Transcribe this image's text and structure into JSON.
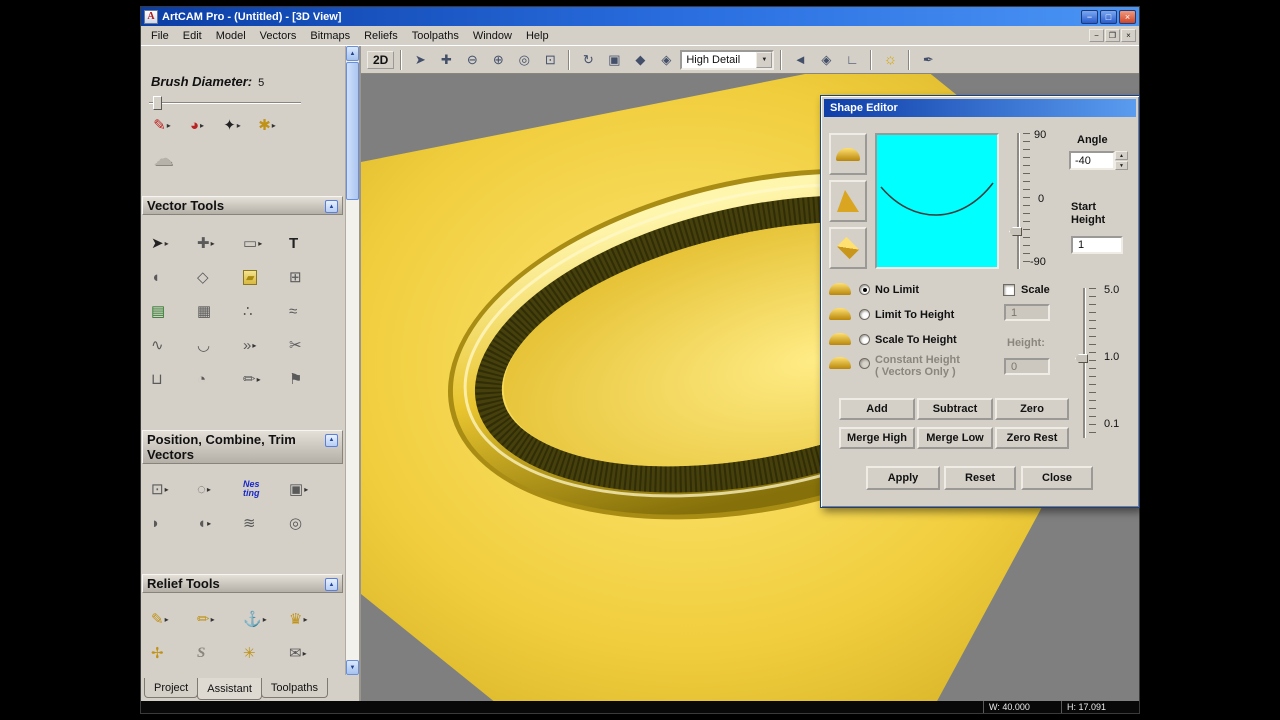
{
  "window": {
    "title": "ArtCAM Pro - (Untitled) - [3D View]",
    "menu": [
      "File",
      "Edit",
      "Model",
      "Vectors",
      "Bitmaps",
      "Reliefs",
      "Toolpaths",
      "Window",
      "Help"
    ],
    "toolbar": {
      "mode_2d": "2D",
      "detail_select": "High Detail"
    },
    "status": {
      "w": "W: 40.000",
      "h": "H: 17.091"
    }
  },
  "panel": {
    "brush_label": "Brush Diameter:",
    "brush_value": "5",
    "vector_tools_header": "Vector Tools",
    "pct_header": "Position, Combine, Trim Vectors",
    "relief_tools_header": "Relief Tools",
    "nesting_1": "Nes",
    "nesting_2": "ting",
    "tabs": [
      "Project",
      "Assistant",
      "Toolpaths"
    ]
  },
  "shape_editor": {
    "title": "Shape Editor",
    "angle_label": "Angle",
    "angle_value": "-40",
    "start_height_label": "Start Height",
    "start_height_value": "1",
    "angle_slider": {
      "top": "90",
      "mid": "0",
      "bottom": "-90"
    },
    "options": [
      "No Limit",
      "Limit To Height",
      "Scale To Height",
      "Constant Height",
      "( Vectors Only )"
    ],
    "scale_label": "Scale",
    "height_label": "Height:",
    "limit_height_value": "1",
    "constant_height_value": "0",
    "height_slider": {
      "top": "5.0",
      "mid": "1.0",
      "bottom": "0.1"
    },
    "buttons": [
      "Add",
      "Subtract",
      "Zero",
      "Merge High",
      "Merge Low",
      "Zero Rest"
    ],
    "actions": [
      "Apply",
      "Reset",
      "Close"
    ]
  },
  "colors": {
    "titlebar_start": "#0b3ea5",
    "titlebar_end": "#4b95f5",
    "panel_bg": "#d4d0c8",
    "view_bg": "#7f7f7f",
    "relief_gold": "#e8c42e",
    "preview_bg": "#00ffff"
  },
  "icons": {
    "app": "A",
    "tri_up": "▲",
    "tri_down": "▼",
    "tri_right": "▸",
    "tri_left": "◄",
    "minimize": "−",
    "maximize": "□",
    "close": "×",
    "restore": "❐",
    "select": "➤",
    "pan": "✚",
    "zoom_out": "⊖",
    "zoom_in": "⊕",
    "zoom_window": "◎",
    "zoom_fit": "⊡",
    "rotate": "↻",
    "shade_flat": "▣",
    "shade_iso": "◆",
    "shade_gouraud": "◈",
    "back": "◄",
    "corner": "∟",
    "bulb": "☼",
    "pen_tool": "✒",
    "pencil": "✎",
    "pie": "◕",
    "spray": "✦",
    "palette": "✱",
    "cloud": "☁",
    "v_select": "➤",
    "v_transform": "✚",
    "v_rect": "▭",
    "v_text": "T",
    "v_shape": "◖",
    "v_poly": "◇",
    "v_measure": "▰",
    "v_block": "⊞",
    "v_table": "▤",
    "v_grid": "▦",
    "v_dots": "∴",
    "v_arcs": "≈",
    "v_wave": "∿",
    "v_arc": "◡",
    "v_join": "»",
    "v_scissors": "✂",
    "v_cyl": "⊔",
    "v_pie": "◔",
    "v_pencil": "✏",
    "v_flag": "⚑",
    "c_align": "⊡",
    "c_circle": "◌",
    "c_window": "▣",
    "c_blob1": "◗",
    "c_blob2": "◖",
    "c_waves": "≋",
    "c_spiral": "◎",
    "r_pen": "✎",
    "r_chisel": "✏",
    "r_anchor": "⚓",
    "r_crown": "♛",
    "r_sprig": "✢",
    "r_s": "S",
    "r_knot": "✳",
    "r_mail": "✉"
  }
}
